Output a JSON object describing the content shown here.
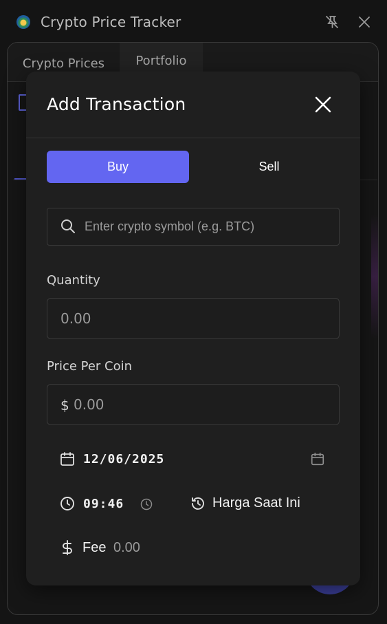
{
  "window": {
    "title": "Crypto Price Tracker",
    "icons": {
      "app": "app-logo-icon",
      "pin": "pin-off-icon",
      "close": "close-icon"
    }
  },
  "main": {
    "tabs": [
      {
        "label": "Crypto Prices",
        "active": false
      },
      {
        "label": "Portfolio",
        "active": true
      }
    ]
  },
  "modal": {
    "title": "Add Transaction",
    "type_toggle": {
      "buy": "Buy",
      "sell": "Sell",
      "selected": "Buy"
    },
    "search": {
      "placeholder": "Enter crypto symbol (e.g. BTC)",
      "value": ""
    },
    "quantity": {
      "label": "Quantity",
      "placeholder": "0.00",
      "value": ""
    },
    "price": {
      "label": "Price Per Coin",
      "prefix": "$",
      "placeholder": "0.00",
      "value": ""
    },
    "date": {
      "value": "12/06/2025"
    },
    "time": {
      "value": "09:46"
    },
    "current_price_button": "Harga Saat Ini",
    "fee": {
      "label": "Fee",
      "value": "0.00"
    }
  },
  "colors": {
    "accent": "#6366f1",
    "modal_bg": "#1f1f1f",
    "page_bg": "#141414",
    "border": "#3a3a3a"
  }
}
